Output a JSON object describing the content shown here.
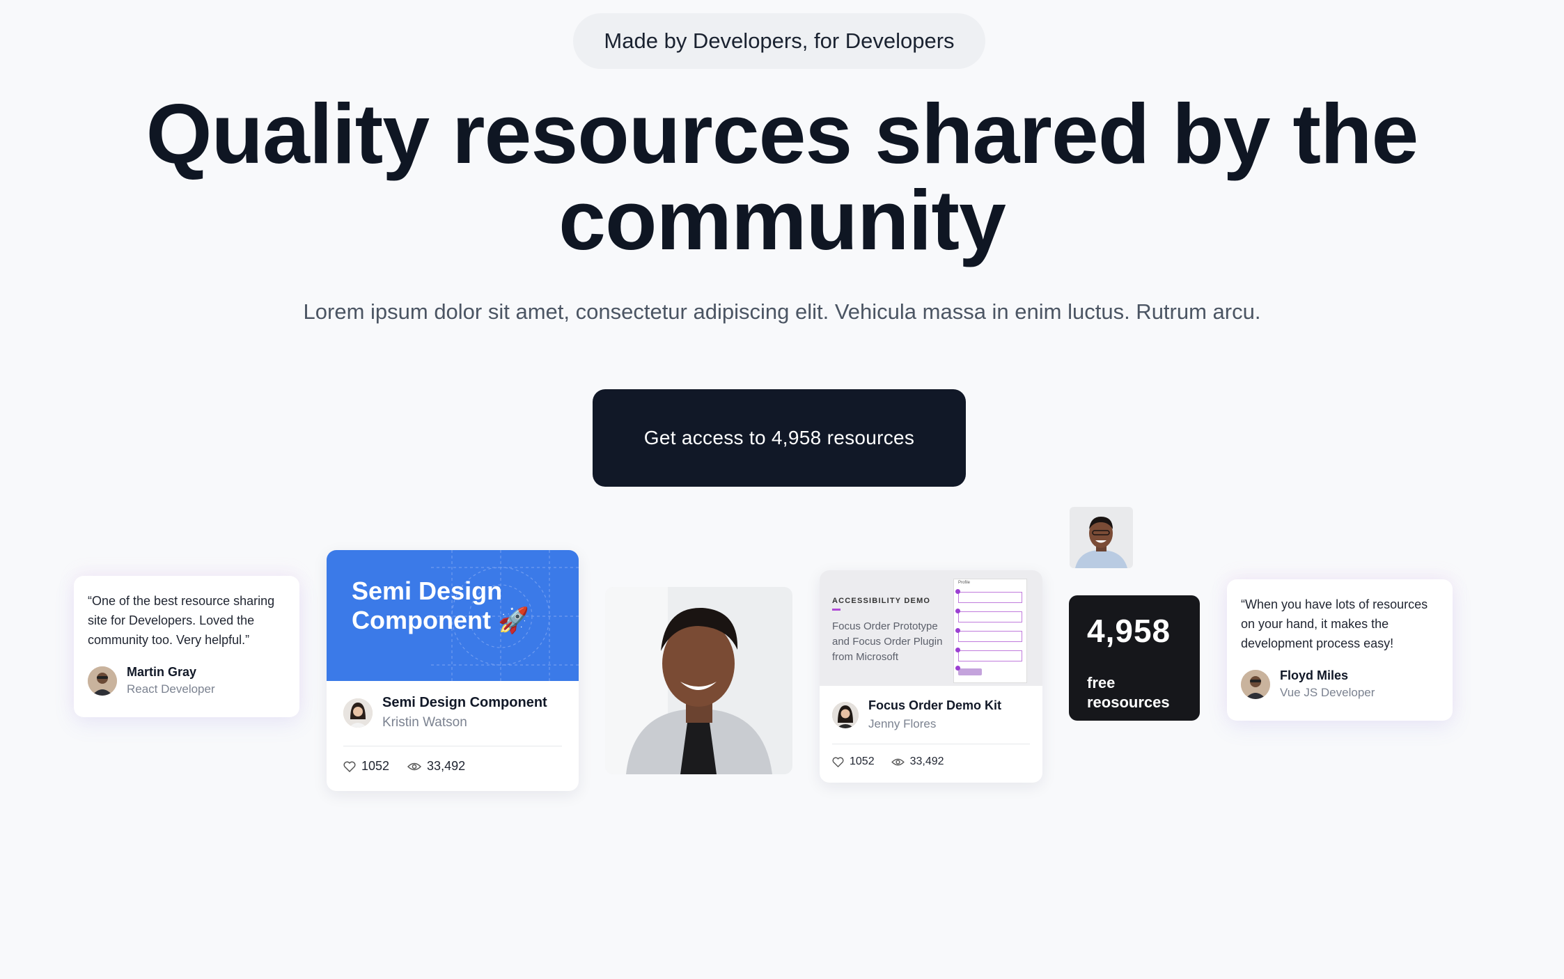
{
  "badge": "Made by Developers, for Developers",
  "hero": {
    "title": "Quality resources shared by the community",
    "subtitle": "Lorem ipsum dolor sit amet, consectetur adipiscing elit. Vehicula massa in enim luctus. Rutrum arcu."
  },
  "cta": {
    "label": "Get access to 4,958 resources"
  },
  "testimonials": [
    {
      "quote": "“One of the best resource sharing site for Developers. Loved the community too. Very helpful.”",
      "name": "Martin Gray",
      "role": "React Developer"
    },
    {
      "quote": "“When you have lots of resources on your hand, it makes the development process easy!",
      "name": "Floyd Miles",
      "role": "Vue JS Developer"
    }
  ],
  "resource_cards": [
    {
      "banner": "Semi Design Component 🚀",
      "title": "Semi Design Component",
      "author": "Kristin Watson",
      "likes": "1052",
      "views": "33,492"
    },
    {
      "kicker": "ACCESSIBILITY DEMO",
      "description": "Focus Order Prototype and Focus Order Plugin from Microsoft",
      "title": "Focus Order Demo Kit",
      "author": "Jenny Flores",
      "likes": "1052",
      "views": "33,492",
      "form_label": "Profile"
    }
  ],
  "stat_card": {
    "number": "4,958",
    "label": "free reosources"
  },
  "colors": {
    "cta_bg": "#111827",
    "banner_blue": "#3b7ae8",
    "stat_bg": "#16171b",
    "page_bg": "#f8f9fb"
  }
}
